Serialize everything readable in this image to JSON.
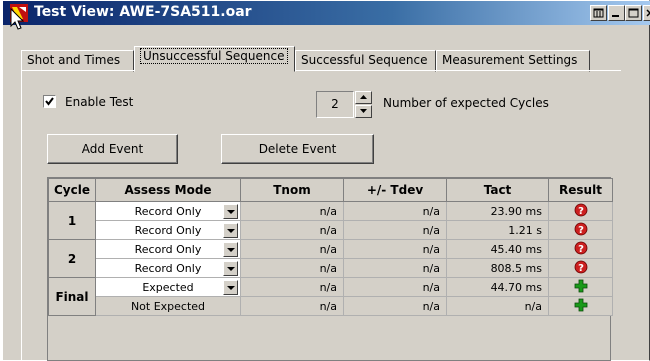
{
  "window": {
    "title": "Test View: AWE-7SA511.oar"
  },
  "tabs": [
    {
      "label": "Shot and Times"
    },
    {
      "label": "Unsuccessful Sequence"
    },
    {
      "label": "Successful Sequence"
    },
    {
      "label": "Measurement Settings"
    }
  ],
  "active_tab": "Unsuccessful Sequence",
  "settings": {
    "enable_test_label": "Enable Test",
    "enable_test_checked": true,
    "cycles_value": "2",
    "cycles_label": "Number of expected Cycles"
  },
  "buttons": {
    "add_event": "Add Event",
    "delete_event": "Delete Event"
  },
  "table": {
    "headers": [
      "Cycle",
      "Assess Mode",
      "Tnom",
      "+/- Tdev",
      "Tact",
      "Result"
    ],
    "cycles": [
      "1",
      "2",
      "Final"
    ],
    "rows": [
      {
        "mode": "Record Only",
        "tnom": "n/a",
        "tdev": "n/a",
        "tact": "23.90 ms",
        "result": "question-icon"
      },
      {
        "mode": "Record Only",
        "tnom": "n/a",
        "tdev": "n/a",
        "tact": "1.21 s",
        "result": "question-icon"
      },
      {
        "mode": "Record Only",
        "tnom": "n/a",
        "tdev": "n/a",
        "tact": "45.40 ms",
        "result": "question-icon"
      },
      {
        "mode": "Record Only",
        "tnom": "n/a",
        "tdev": "n/a",
        "tact": "808.5 ms",
        "result": "question-icon"
      },
      {
        "mode": "Expected",
        "tnom": "n/a",
        "tdev": "n/a",
        "tact": "44.70 ms",
        "result": "plus-icon"
      },
      {
        "mode": "Not Expected",
        "tnom": "n/a",
        "tdev": "n/a",
        "tact": "n/a",
        "result": "plus-icon"
      }
    ]
  },
  "colors": {
    "title_start": "#0a246a",
    "title_end": "#a6caf0",
    "face": "#d4d0c8",
    "fail": "#cc2020",
    "pass": "#1a9a1a"
  }
}
